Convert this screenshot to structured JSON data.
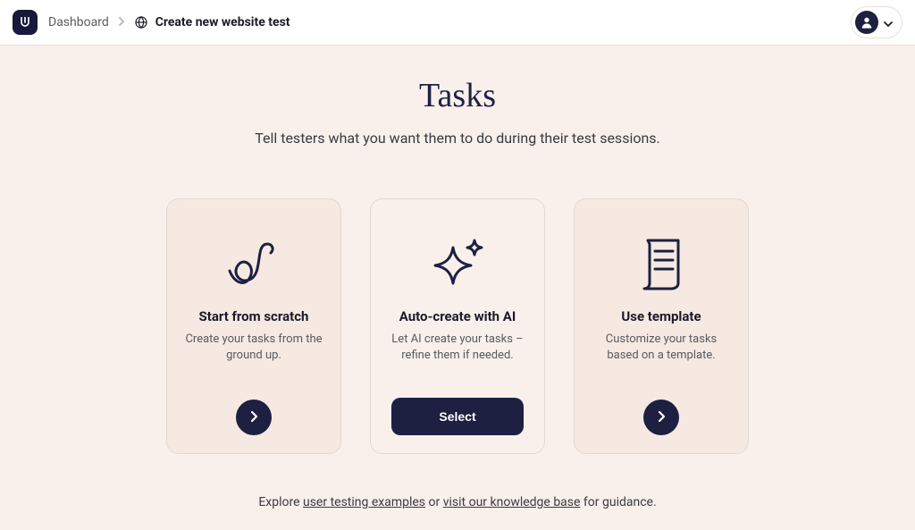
{
  "breadcrumb": {
    "root": "Dashboard",
    "current": "Create new website test"
  },
  "page": {
    "title": "Tasks",
    "subtitle": "Tell testers what you want them to do during their test sessions."
  },
  "cards": {
    "scratch": {
      "title": "Start from scratch",
      "desc": "Create your tasks from the ground up."
    },
    "ai": {
      "title": "Auto-create with AI",
      "desc": "Let AI create your tasks – refine them if needed.",
      "button": "Select"
    },
    "template": {
      "title": "Use template",
      "desc": "Customize your tasks based on a template."
    }
  },
  "footer": {
    "pre": "Explore ",
    "link1": "user testing examples",
    "mid": " or ",
    "link2": "visit our knowledge base",
    "post": " for guidance."
  }
}
